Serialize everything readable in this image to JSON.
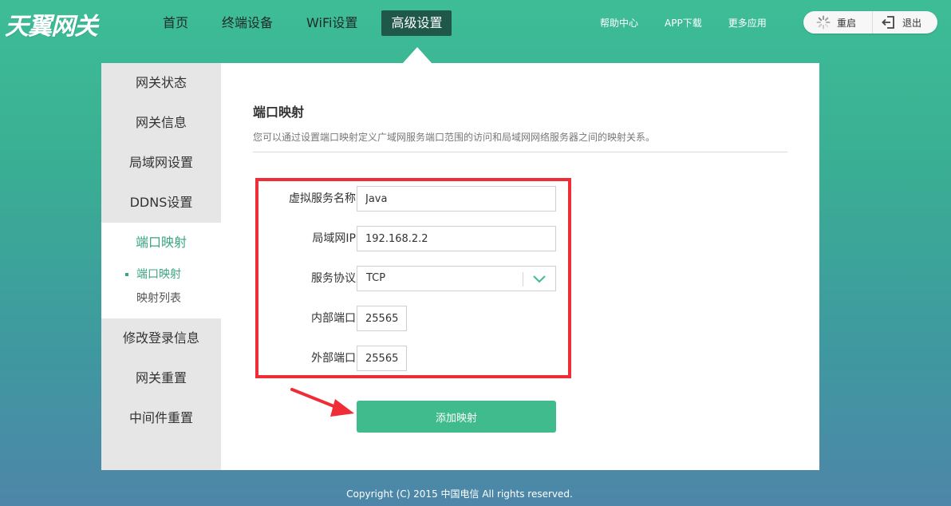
{
  "brand": {
    "logo_text": "天翼网关"
  },
  "main_nav": [
    {
      "label": "首页",
      "active": false
    },
    {
      "label": "终端设备",
      "active": false
    },
    {
      "label": "WiFi设置",
      "active": false
    },
    {
      "label": "高级设置",
      "active": true
    }
  ],
  "top_links": [
    "帮助中心",
    "APP下载",
    "更多应用"
  ],
  "actions": {
    "restart": "重启",
    "logout": "退出"
  },
  "sidebar": {
    "items_before": [
      "网关状态",
      "网关信息",
      "局域网设置",
      "DDNS设置"
    ],
    "active_group": {
      "label": "端口映射",
      "sub_items": [
        {
          "label": "端口映射",
          "active": true
        },
        {
          "label": "映射列表",
          "active": false
        }
      ]
    },
    "items_after": [
      "修改登录信息",
      "网关重置",
      "中间件重置"
    ]
  },
  "section": {
    "title": "端口映射",
    "description": "您可以通过设置端口映射定义广域网服务端口范围的访问和局域网网络服务器之间的映射关系。"
  },
  "form": {
    "service_name": {
      "label": "虚拟服务名称",
      "value": "Java"
    },
    "lan_ip": {
      "label": "局域网IP",
      "value": "192.168.2.2"
    },
    "protocol": {
      "label": "服务协议",
      "value": "TCP"
    },
    "internal_port": {
      "label": "内部端口",
      "value": "25565"
    },
    "external_port": {
      "label": "外部端口",
      "value": "25565"
    },
    "submit_label": "添加映射"
  },
  "footer": {
    "text": "Copyright (C) 2015 中国电信 All rights reserved."
  },
  "colors": {
    "accent": "#3fbb8e",
    "nav_active": "#1f5748",
    "highlight_border": "#ee2d37"
  }
}
